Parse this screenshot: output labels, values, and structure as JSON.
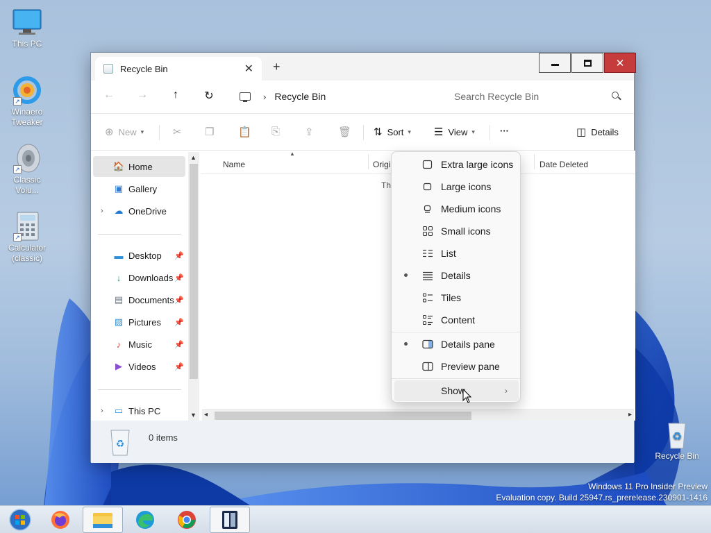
{
  "desktop": {
    "icons": [
      {
        "label": "This PC"
      },
      {
        "label": "Winaero Tweaker"
      },
      {
        "label": "Classic Volu..."
      },
      {
        "label": "Calculator (classic)"
      },
      {
        "label": "Recycle Bin"
      }
    ],
    "watermark_line1": "Windows 11 Pro Insider Preview",
    "watermark_line2": "Evaluation copy. Build 25947.rs_prerelease.230901-1416"
  },
  "window": {
    "tab_title": "Recycle Bin",
    "tab_close": "✕",
    "new_tab": "+",
    "buttons": {
      "close": "✕"
    }
  },
  "address": {
    "back": "←",
    "forward": "→",
    "up": "↑",
    "refresh": "↻",
    "separator": "›",
    "location": "Recycle Bin",
    "search_placeholder": "Search Recycle Bin"
  },
  "commands": {
    "new": "New",
    "sort": "Sort",
    "view": "View",
    "more": "···",
    "details": "Details"
  },
  "nav": {
    "items": [
      {
        "label": "Home",
        "icon": "home-icon"
      },
      {
        "label": "Gallery",
        "icon": "gallery-icon"
      },
      {
        "label": "OneDrive",
        "icon": "cloud-icon"
      },
      {
        "label": "Desktop",
        "icon": "desktop-icon"
      },
      {
        "label": "Downloads",
        "icon": "download-icon"
      },
      {
        "label": "Documents",
        "icon": "document-icon"
      },
      {
        "label": "Pictures",
        "icon": "pictures-icon"
      },
      {
        "label": "Music",
        "icon": "music-icon"
      },
      {
        "label": "Videos",
        "icon": "video-icon"
      },
      {
        "label": "This PC",
        "icon": "computer-icon"
      }
    ]
  },
  "content": {
    "columns": [
      "Name",
      "Origi",
      "Date Deleted"
    ],
    "empty_text": "Th"
  },
  "status": {
    "count": "0 items"
  },
  "view_menu": {
    "items": [
      {
        "label": "Extra large icons",
        "selected": false
      },
      {
        "label": "Large icons",
        "selected": false
      },
      {
        "label": "Medium icons",
        "selected": false
      },
      {
        "label": "Small icons",
        "selected": false
      },
      {
        "label": "List",
        "selected": false
      },
      {
        "label": "Details",
        "selected": true
      },
      {
        "label": "Tiles",
        "selected": false
      },
      {
        "label": "Content",
        "selected": false
      },
      {
        "label": "Details pane",
        "selected": true
      },
      {
        "label": "Preview pane",
        "selected": false
      },
      {
        "label": "Show",
        "selected": false
      }
    ],
    "submenu_arrow": "›"
  },
  "taskbar": {
    "apps": [
      "start-orb",
      "firefox",
      "file-explorer",
      "edge",
      "chrome",
      "app-tweaker"
    ],
    "active": "file-explorer"
  },
  "colors": {
    "accent": "#005fb8",
    "close_button": "#c63c3c",
    "wallpaper_blue": "#1f4fb8"
  }
}
